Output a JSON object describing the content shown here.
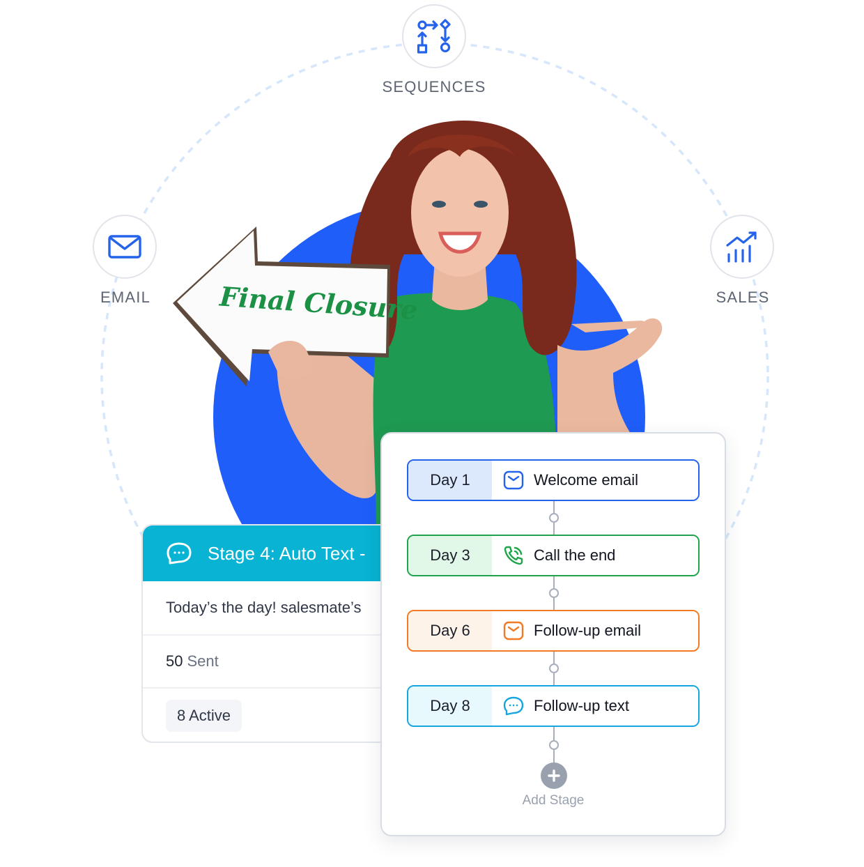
{
  "orbit_nodes": {
    "sequences": {
      "label": "SEQUENCES",
      "icon": "sequences-flow-icon"
    },
    "email": {
      "label": "EMAIL",
      "icon": "envelope-icon"
    },
    "sales": {
      "label": "SALES",
      "icon": "sales-growth-chart-icon"
    }
  },
  "hero": {
    "sign_text": "Final Closure",
    "image_description": "smiling woman with curly red hair in green top holding arrow sign and pointing"
  },
  "stage_card": {
    "title": "Stage 4: Auto Text -",
    "icon": "chat-bubble-icon",
    "message_preview": "Today’s the day! salesmate’s ",
    "sent_count": "50",
    "sent_label": "Sent",
    "active_label": "8 Active"
  },
  "sequence": {
    "steps": [
      {
        "day": "Day 1",
        "label": "Welcome email",
        "icon": "envelope-icon",
        "color": "#2563eb",
        "tint": "#dce8fc"
      },
      {
        "day": "Day 3",
        "label": "Call the end",
        "icon": "phone-call-icon",
        "color": "#1fa44c",
        "tint": "#e1f8e8"
      },
      {
        "day": "Day 6",
        "label": "Follow-up email",
        "icon": "envelope-icon",
        "color": "#f27a24",
        "tint": "#fef3e8"
      },
      {
        "day": "Day 8",
        "label": "Follow-up text",
        "icon": "chat-bubble-icon",
        "color": "#16a6df",
        "tint": "#e8f9fd"
      }
    ],
    "add_stage_label": "Add Stage"
  },
  "colors": {
    "primary_blue": "#1f5ef8",
    "icon_blue": "#2563eb",
    "stage_header": "#08b3d3",
    "orbit_dash": "#d6e6fb"
  }
}
